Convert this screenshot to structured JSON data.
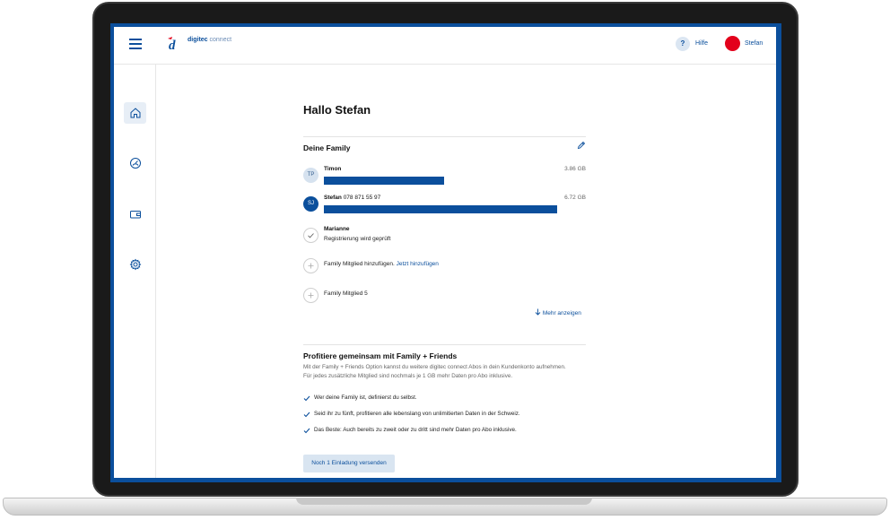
{
  "header": {
    "logo_brand": "digitec",
    "logo_product": "connect",
    "help_icon": "?",
    "help_label": "Hilfe",
    "user_label": "Stefan"
  },
  "sidebar": {
    "items": [
      {
        "icon": "home-icon"
      },
      {
        "icon": "speedometer-icon"
      },
      {
        "icon": "wallet-icon"
      },
      {
        "icon": "gear-icon"
      }
    ]
  },
  "main": {
    "greeting": "Hallo Stefan",
    "family_title": "Deine Family",
    "members": [
      {
        "initials": "TP",
        "name": "Timon",
        "number": "",
        "usage": "3.86 GB",
        "share": 0.46
      },
      {
        "initials": "SJ",
        "name": "Stefan",
        "number": "078 871 55 97",
        "usage": "6.72 GB",
        "share": 0.89
      },
      {
        "initials": "",
        "name": "Marianne",
        "status": "Registrierung wird geprüft"
      },
      {
        "text": "Family Mitglied hinzufügen.",
        "link": "Jetzt hinzufügen"
      },
      {
        "text": "Family Mitglied 5"
      }
    ],
    "more_link": "Mehr anzeigen",
    "promo_title": "Profitiere gemeinsam mit Family + Friends",
    "promo_desc": "Mit der Family + Friends Option kannst du weitere digitec connect Abos in dein Kundenkonto aufnehmen. Für jedes zusätzliche Mitglied sind nochmals je 1 GB mehr Daten pro Abo inklusive.",
    "benefits": [
      "Wer deine Family ist, definierst du selbst.",
      "Seid ihr zu fünft, profitieren alle lebenslang von unlimitierten Daten in der Schweiz.",
      "Das Beste: Auch bereits zu zweit oder zu dritt sind mehr Daten pro Abo inklusive."
    ],
    "invite_button": "Noch 1 Einladung versenden"
  },
  "colors": {
    "brand_blue": "#0b4f9c",
    "avatar_red": "#e3001b",
    "button_bg": "#d9e5f1"
  }
}
